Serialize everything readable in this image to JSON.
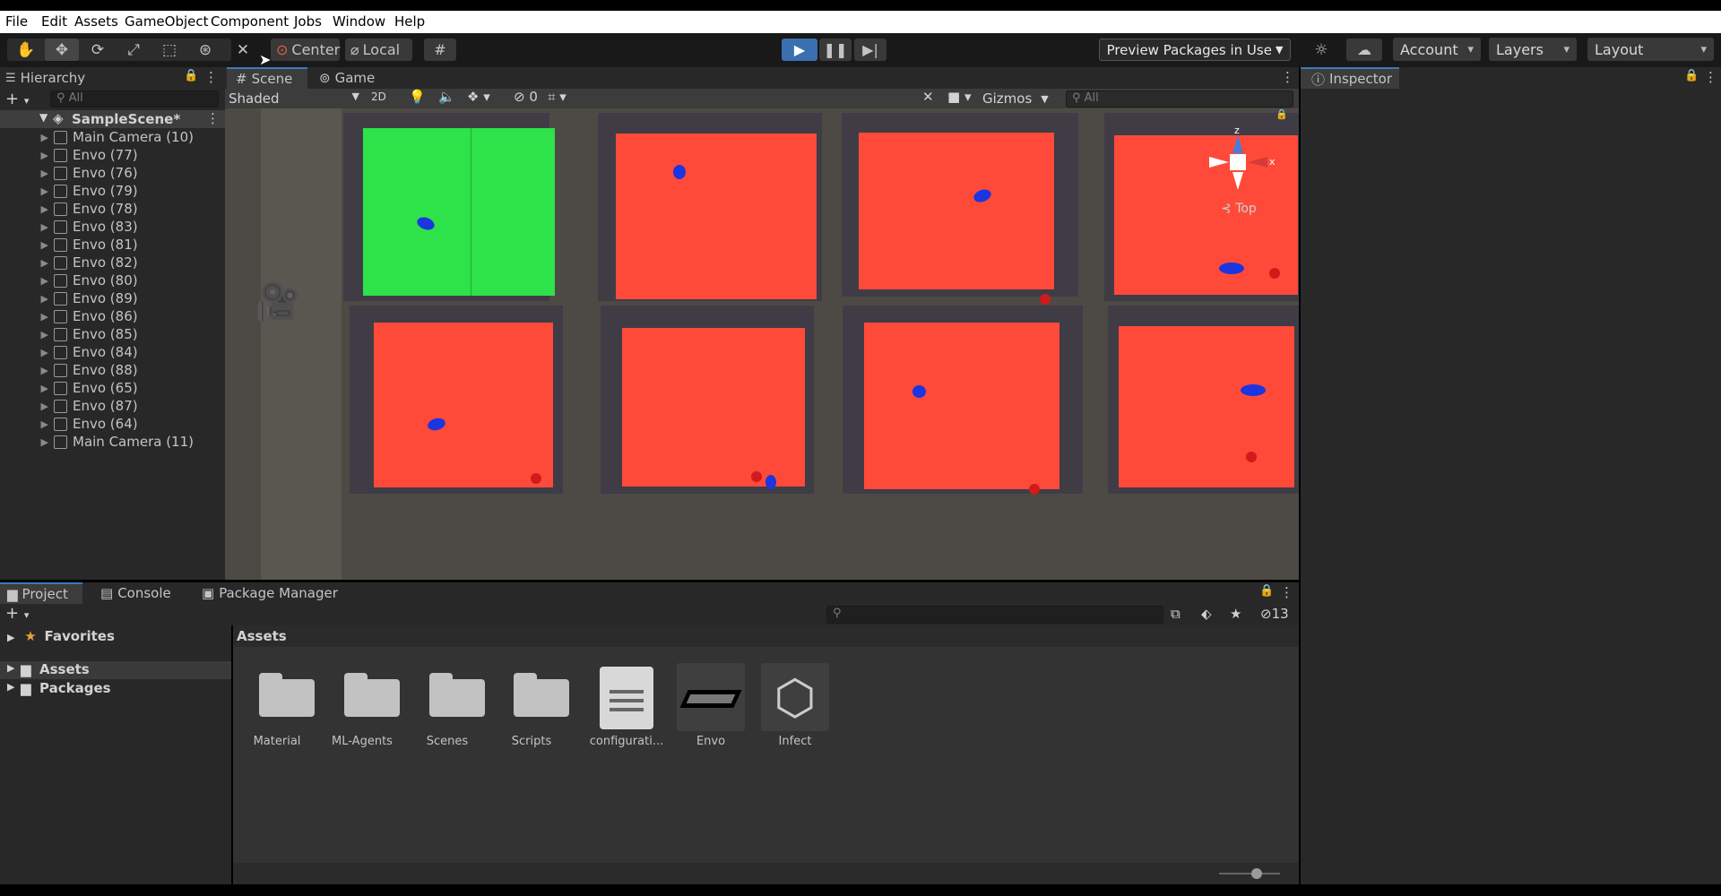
{
  "menu": [
    "File",
    "Edit",
    "Assets",
    "GameObject",
    "Component",
    "Jobs",
    "Window",
    "Help"
  ],
  "toolbar": {
    "pivot": "Center",
    "space": "Local",
    "preview_packages": "Preview Packages in Use",
    "account": "Account",
    "layers": "Layers",
    "layout": "Layout"
  },
  "hierarchy": {
    "tab": "Hierarchy",
    "search_placeholder": "All",
    "scene": "SampleScene*",
    "items": [
      "Main Camera (10)",
      "Envo (77)",
      "Envo (76)",
      "Envo (79)",
      "Envo (78)",
      "Envo (83)",
      "Envo (81)",
      "Envo (82)",
      "Envo (80)",
      "Envo (89)",
      "Envo (86)",
      "Envo (85)",
      "Envo (84)",
      "Envo (88)",
      "Envo (65)",
      "Envo (87)",
      "Envo (64)",
      "Main Camera (11)"
    ]
  },
  "scene_view": {
    "tab_scene": "Scene",
    "tab_game": "Game",
    "shading": "Shaded",
    "mode_2d": "2D",
    "hidden_count": "0",
    "gizmos": "Gizmos",
    "search_placeholder": "All",
    "gizmo_view": "Top",
    "axis_z": "z",
    "axis_x": "x"
  },
  "inspector": {
    "tab": "Inspector"
  },
  "bottom": {
    "tab_project": "Project",
    "tab_console": "Console",
    "tab_package_manager": "Package Manager",
    "favorites": "Favorites",
    "assets_folder": "Assets",
    "packages_folder": "Packages",
    "breadcrumb": "Assets",
    "hidden_packages": "13",
    "assets": [
      "Material",
      "ML-Agents",
      "Scenes",
      "Scripts",
      "configurati...",
      "Envo",
      "Infect"
    ]
  },
  "colors": {
    "green_field": "#2ee24a",
    "red_field": "#ff4a3a",
    "agent_blue": "#1b35e0",
    "accent": "#3a79bb"
  }
}
